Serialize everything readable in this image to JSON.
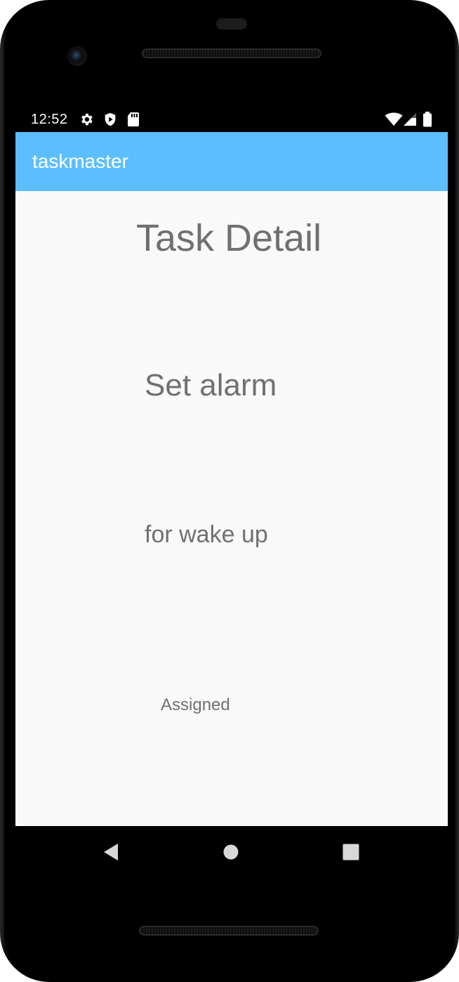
{
  "status_bar": {
    "time": "12:52",
    "icons": [
      "gear-icon",
      "shield-play-icon",
      "sd-card-icon",
      "wifi-icon",
      "signal-icon",
      "battery-icon"
    ]
  },
  "app_bar": {
    "title": "taskmaster",
    "color": "#5bbfff"
  },
  "task_detail": {
    "heading": "Task Detail",
    "title": "Set alarm",
    "body": "for wake up",
    "state": "Assigned"
  },
  "nav_bar": {
    "buttons": [
      "back-icon",
      "home-icon",
      "recents-icon"
    ]
  },
  "colors": {
    "text": "#707070",
    "background": "#f9f9f9"
  }
}
